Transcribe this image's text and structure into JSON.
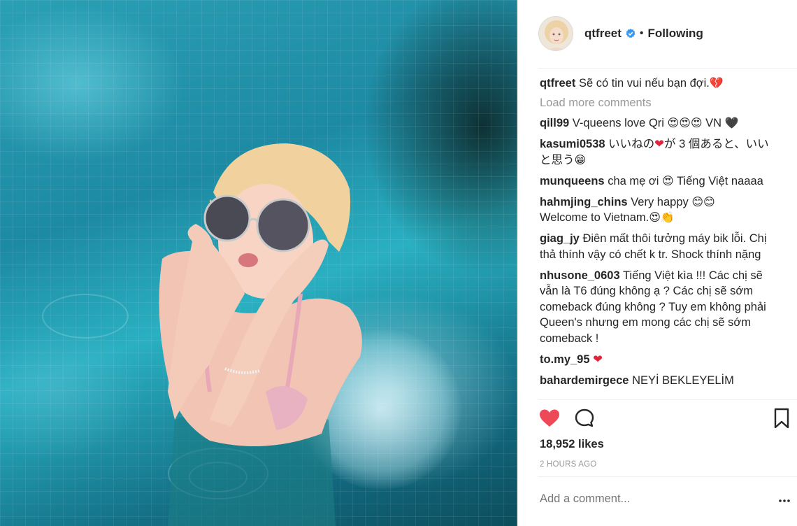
{
  "post": {
    "username": "qtfreet",
    "separator": "•",
    "follow_label": "Following",
    "caption_user": "qtfreet",
    "caption_text": "Sẽ có tin vui nếu bạn đợi.",
    "caption_emoji": "💔",
    "load_more": "Load more comments",
    "comments": [
      {
        "user": "qill99",
        "text": "V-queens love Qri",
        "emoji": "😍😍😍",
        "tail": "VN",
        "tail_emoji": "🖤"
      },
      {
        "user": "kasumi0538",
        "text_a": "いいねの",
        "heart": "❤",
        "text_b": "が 3 個あると、いいと思う",
        "emoji": "😁"
      },
      {
        "user": "munqueens",
        "text": "cha mẹ ơi",
        "emoji": "😍",
        "tail": "Tiếng Việt naaaa"
      },
      {
        "user": "hahmjing_chins",
        "text": "Very happy",
        "emoji": "😊😊",
        "line2": "Welcome to Vietnam.",
        "emoji2": "😍👏"
      },
      {
        "user": "giag_jy",
        "text": "Điên mất thôi tưởng máy bik lỗi. Chị thả thính vậy có chết k tr. Shock thính nặng"
      },
      {
        "user": "nhusone_0603",
        "text": "Tiếng Việt kìa !!! Các chị sẽ vẫn là T6 đúng không ạ ? Các chị sẽ sớm comeback đúng không ? Tuy em không phải Queen's nhưng em mong các chị sẽ sớm comeback !"
      },
      {
        "user": "to.my_95",
        "heart": "❤"
      },
      {
        "user": "bahardemirgece",
        "text": "NEYİ BEKLEYELİM"
      }
    ],
    "likes": "18,952 likes",
    "timestamp": "2 HOURS AGO",
    "add_comment_placeholder": "Add a comment...",
    "more_dots": "..."
  },
  "icons": {
    "like": "heart-icon",
    "comment": "speech-bubble-icon",
    "save": "bookmark-icon",
    "verified": "verified-badge-icon"
  },
  "colors": {
    "like_red": "#ed4956",
    "verified_blue": "#3897f0",
    "muted_text": "#999999"
  }
}
